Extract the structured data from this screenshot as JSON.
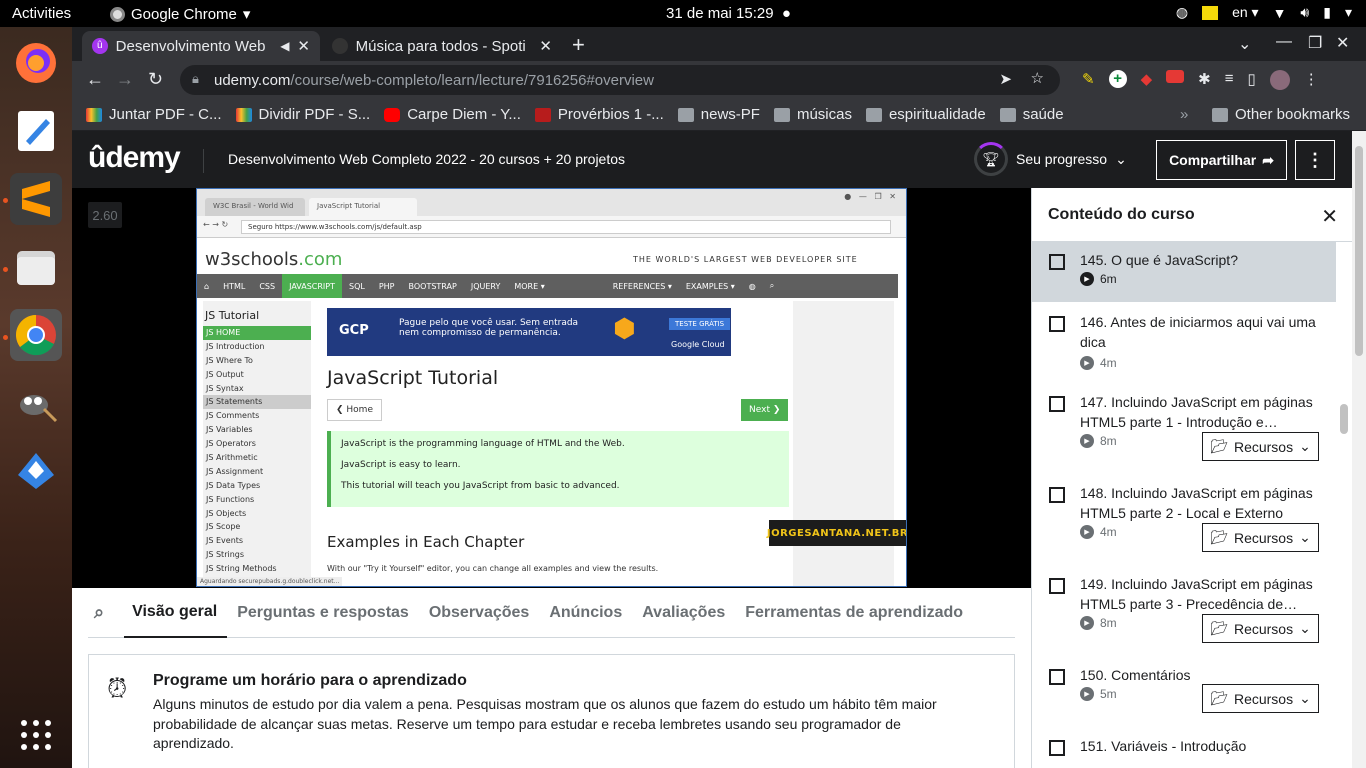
{
  "system": {
    "activities": "Activities",
    "app_name": "Google Chrome",
    "clock": "31 de mai  15:29",
    "lang": "en"
  },
  "browser": {
    "tabs": [
      {
        "title": "Desenvolvimento Web",
        "active": true
      },
      {
        "title": "Música para todos - Spoti",
        "active": false
      }
    ],
    "url_host": "udemy.com",
    "url_path": "/course/web-completo/learn/lecture/7916256#overview",
    "bookmarks": [
      {
        "label": "Juntar PDF - C...",
        "color": "#e53935"
      },
      {
        "label": "Dividir PDF - S...",
        "color": "#e53935"
      },
      {
        "label": "Carpe Diem - Y...",
        "color": "#ff0000"
      },
      {
        "label": "Provérbios 1 -...",
        "color": "#b71c1c"
      },
      {
        "label": "news-PF",
        "color": "#9aa0a6"
      },
      {
        "label": "músicas",
        "color": "#9aa0a6"
      },
      {
        "label": "espiritualidade",
        "color": "#9aa0a6"
      },
      {
        "label": "saúde",
        "color": "#9aa0a6"
      }
    ],
    "other_bookmarks": "Other bookmarks"
  },
  "udemy": {
    "logo": "ûdemy",
    "course_title": "Desenvolvimento Web Completo 2022 - 20 cursos + 20 projetos",
    "progress_label": "Seu progresso",
    "share_label": "Compartilhar",
    "speed": "2.60"
  },
  "video": {
    "w3tabs": [
      "W3C Brasil - World Wid",
      "JavaScript Tutorial"
    ],
    "w3url": "Seguro  https://www.w3schools.com/js/default.asp",
    "w3logo": "w3schools",
    "w3logo_ext": ".com",
    "slogan": "THE WORLD'S LARGEST WEB DEVELOPER SITE",
    "nav": [
      "HTML",
      "CSS",
      "JAVASCRIPT",
      "SQL",
      "PHP",
      "BOOTSTRAP",
      "JQUERY",
      "MORE ▾"
    ],
    "nav_right": [
      "REFERENCES ▾",
      "EXAMPLES ▾"
    ],
    "side_title": "JS Tutorial",
    "side_items": [
      "JS HOME",
      "JS Introduction",
      "JS Where To",
      "JS Output",
      "JS Syntax",
      "JS Statements",
      "JS Comments",
      "JS Variables",
      "JS Operators",
      "JS Arithmetic",
      "JS Assignment",
      "JS Data Types",
      "JS Functions",
      "JS Objects",
      "JS Scope",
      "JS Events",
      "JS Strings",
      "JS String Methods"
    ],
    "ad_brand": "GCP",
    "ad_text": "Pague pelo que você usar. Sem entrada nem compromisso de permanência.",
    "ad_btn": "TESTE GRÁTIS",
    "ad_cloud": "Google Cloud",
    "h1": "JavaScript Tutorial",
    "home_btn": "❮ Home",
    "next_btn": "Next ❯",
    "note": [
      "JavaScript is the programming language of HTML and the Web.",
      "JavaScript is easy to learn.",
      "This tutorial will teach you JavaScript from basic to advanced."
    ],
    "h2": "Examples in Each Chapter",
    "ex": "With our \"Try it Yourself\" editor, you can change all examples and view the results.",
    "watermark": "JORGESANTANA.NET.BR",
    "status": "Aguardando securepubads.g.doubleclick.net..."
  },
  "content_tabs": [
    "Visão geral",
    "Perguntas e respostas",
    "Observações",
    "Anúncios",
    "Avaliações",
    "Ferramentas de aprendizado"
  ],
  "schedule": {
    "title": "Programe um horário para o aprendizado",
    "text": "Alguns minutos de estudo por dia valem a pena. Pesquisas mostram que os alunos que fazem do estudo um hábito têm maior probabilidade de alcançar suas metas. Reserve um tempo para estudar e receba lembretes usando seu programador de aprendizado."
  },
  "sidebar": {
    "title": "Conteúdo do curso",
    "resources_label": "Recursos",
    "lectures": [
      {
        "title": "145. O que é JavaScript?",
        "duration": "6m",
        "current": true
      },
      {
        "title": "146. Antes de iniciarmos aqui vai uma dica",
        "duration": "4m"
      },
      {
        "title": "147. Incluindo JavaScript em páginas HTML5 parte 1 - Introdução e…",
        "duration": "8m",
        "resources": true
      },
      {
        "title": "148. Incluindo JavaScript em páginas HTML5 parte 2 - Local e Externo",
        "duration": "4m",
        "resources": true
      },
      {
        "title": "149. Incluindo JavaScript em páginas HTML5 parte 3 - Precedência de…",
        "duration": "8m",
        "resources": true
      },
      {
        "title": "150. Comentários",
        "duration": "5m",
        "resources": true
      },
      {
        "title": "151. Variáveis - Introdução",
        "duration": ""
      }
    ]
  }
}
